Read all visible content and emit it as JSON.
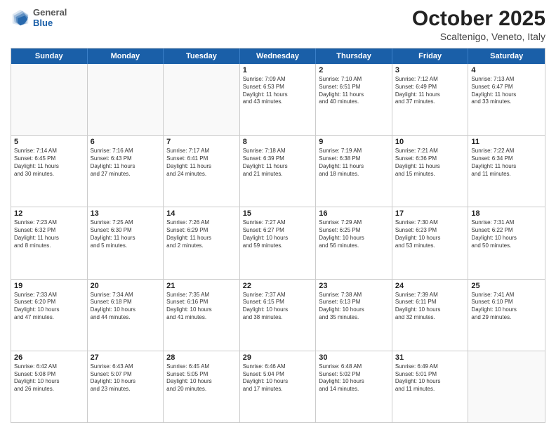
{
  "header": {
    "logo": {
      "general": "General",
      "blue": "Blue"
    },
    "month": "October 2025",
    "location": "Scaltenigo, Veneto, Italy"
  },
  "weekdays": [
    "Sunday",
    "Monday",
    "Tuesday",
    "Wednesday",
    "Thursday",
    "Friday",
    "Saturday"
  ],
  "rows": [
    [
      {
        "day": "",
        "content": ""
      },
      {
        "day": "",
        "content": ""
      },
      {
        "day": "",
        "content": ""
      },
      {
        "day": "1",
        "content": "Sunrise: 7:09 AM\nSunset: 6:53 PM\nDaylight: 11 hours\nand 43 minutes."
      },
      {
        "day": "2",
        "content": "Sunrise: 7:10 AM\nSunset: 6:51 PM\nDaylight: 11 hours\nand 40 minutes."
      },
      {
        "day": "3",
        "content": "Sunrise: 7:12 AM\nSunset: 6:49 PM\nDaylight: 11 hours\nand 37 minutes."
      },
      {
        "day": "4",
        "content": "Sunrise: 7:13 AM\nSunset: 6:47 PM\nDaylight: 11 hours\nand 33 minutes."
      }
    ],
    [
      {
        "day": "5",
        "content": "Sunrise: 7:14 AM\nSunset: 6:45 PM\nDaylight: 11 hours\nand 30 minutes."
      },
      {
        "day": "6",
        "content": "Sunrise: 7:16 AM\nSunset: 6:43 PM\nDaylight: 11 hours\nand 27 minutes."
      },
      {
        "day": "7",
        "content": "Sunrise: 7:17 AM\nSunset: 6:41 PM\nDaylight: 11 hours\nand 24 minutes."
      },
      {
        "day": "8",
        "content": "Sunrise: 7:18 AM\nSunset: 6:39 PM\nDaylight: 11 hours\nand 21 minutes."
      },
      {
        "day": "9",
        "content": "Sunrise: 7:19 AM\nSunset: 6:38 PM\nDaylight: 11 hours\nand 18 minutes."
      },
      {
        "day": "10",
        "content": "Sunrise: 7:21 AM\nSunset: 6:36 PM\nDaylight: 11 hours\nand 15 minutes."
      },
      {
        "day": "11",
        "content": "Sunrise: 7:22 AM\nSunset: 6:34 PM\nDaylight: 11 hours\nand 11 minutes."
      }
    ],
    [
      {
        "day": "12",
        "content": "Sunrise: 7:23 AM\nSunset: 6:32 PM\nDaylight: 11 hours\nand 8 minutes."
      },
      {
        "day": "13",
        "content": "Sunrise: 7:25 AM\nSunset: 6:30 PM\nDaylight: 11 hours\nand 5 minutes."
      },
      {
        "day": "14",
        "content": "Sunrise: 7:26 AM\nSunset: 6:29 PM\nDaylight: 11 hours\nand 2 minutes."
      },
      {
        "day": "15",
        "content": "Sunrise: 7:27 AM\nSunset: 6:27 PM\nDaylight: 10 hours\nand 59 minutes."
      },
      {
        "day": "16",
        "content": "Sunrise: 7:29 AM\nSunset: 6:25 PM\nDaylight: 10 hours\nand 56 minutes."
      },
      {
        "day": "17",
        "content": "Sunrise: 7:30 AM\nSunset: 6:23 PM\nDaylight: 10 hours\nand 53 minutes."
      },
      {
        "day": "18",
        "content": "Sunrise: 7:31 AM\nSunset: 6:22 PM\nDaylight: 10 hours\nand 50 minutes."
      }
    ],
    [
      {
        "day": "19",
        "content": "Sunrise: 7:33 AM\nSunset: 6:20 PM\nDaylight: 10 hours\nand 47 minutes."
      },
      {
        "day": "20",
        "content": "Sunrise: 7:34 AM\nSunset: 6:18 PM\nDaylight: 10 hours\nand 44 minutes."
      },
      {
        "day": "21",
        "content": "Sunrise: 7:35 AM\nSunset: 6:16 PM\nDaylight: 10 hours\nand 41 minutes."
      },
      {
        "day": "22",
        "content": "Sunrise: 7:37 AM\nSunset: 6:15 PM\nDaylight: 10 hours\nand 38 minutes."
      },
      {
        "day": "23",
        "content": "Sunrise: 7:38 AM\nSunset: 6:13 PM\nDaylight: 10 hours\nand 35 minutes."
      },
      {
        "day": "24",
        "content": "Sunrise: 7:39 AM\nSunset: 6:11 PM\nDaylight: 10 hours\nand 32 minutes."
      },
      {
        "day": "25",
        "content": "Sunrise: 7:41 AM\nSunset: 6:10 PM\nDaylight: 10 hours\nand 29 minutes."
      }
    ],
    [
      {
        "day": "26",
        "content": "Sunrise: 6:42 AM\nSunset: 5:08 PM\nDaylight: 10 hours\nand 26 minutes."
      },
      {
        "day": "27",
        "content": "Sunrise: 6:43 AM\nSunset: 5:07 PM\nDaylight: 10 hours\nand 23 minutes."
      },
      {
        "day": "28",
        "content": "Sunrise: 6:45 AM\nSunset: 5:05 PM\nDaylight: 10 hours\nand 20 minutes."
      },
      {
        "day": "29",
        "content": "Sunrise: 6:46 AM\nSunset: 5:04 PM\nDaylight: 10 hours\nand 17 minutes."
      },
      {
        "day": "30",
        "content": "Sunrise: 6:48 AM\nSunset: 5:02 PM\nDaylight: 10 hours\nand 14 minutes."
      },
      {
        "day": "31",
        "content": "Sunrise: 6:49 AM\nSunset: 5:01 PM\nDaylight: 10 hours\nand 11 minutes."
      },
      {
        "day": "",
        "content": ""
      }
    ]
  ]
}
